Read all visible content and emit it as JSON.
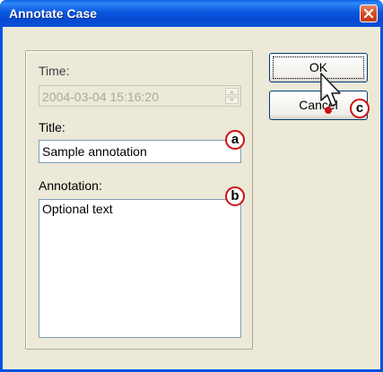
{
  "window": {
    "title": "Annotate Case"
  },
  "form": {
    "time_label": "Time:",
    "time_value": "2004-03-04 15:16:20",
    "title_label": "Title:",
    "title_value": "Sample annotation",
    "annotation_label": "Annotation:",
    "annotation_value": "Optional text"
  },
  "buttons": {
    "ok_label": "OK",
    "cancel_label": "Cancel"
  },
  "callouts": {
    "a": "a",
    "b": "b",
    "c": "c"
  },
  "icons": {
    "close": "close-icon",
    "spin_up": "spin-up-icon",
    "spin_down": "spin-down-icon",
    "cursor": "mouse-pointer-icon"
  },
  "colors": {
    "titlebar": "#0a58e0",
    "dialog_bg": "#ece9d8",
    "callout_ring": "#cc1111"
  }
}
